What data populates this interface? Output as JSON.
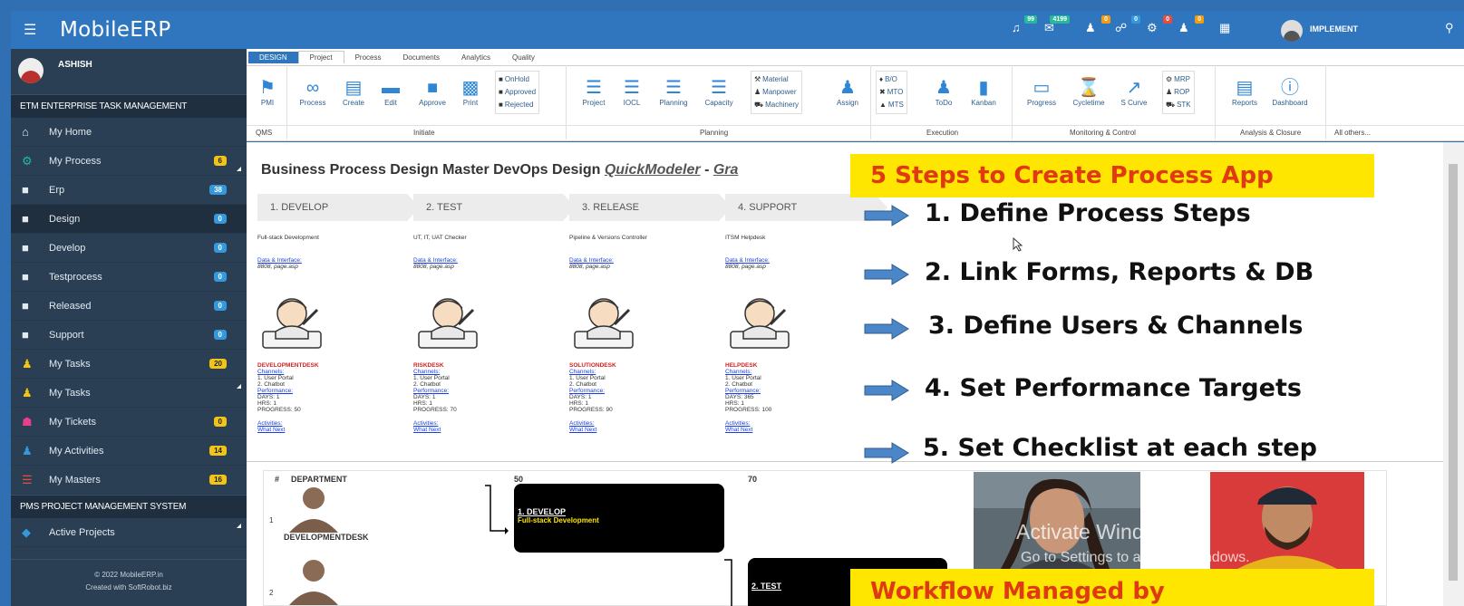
{
  "brand": "MobileERP",
  "user": "ASHISH",
  "sidebar": {
    "section1": "ETM ENTERPRISE TASK MANAGEMENT",
    "items": [
      {
        "label": "My Home",
        "badge": ""
      },
      {
        "label": "My Process",
        "badge": "6"
      },
      {
        "label": "Erp",
        "badge": "38"
      },
      {
        "label": "Design",
        "badge": "0"
      },
      {
        "label": "Develop",
        "badge": "0"
      },
      {
        "label": "Testprocess",
        "badge": "0"
      },
      {
        "label": "Released",
        "badge": "0"
      },
      {
        "label": "Support",
        "badge": "0"
      },
      {
        "label": "My Tasks",
        "badge": "20"
      },
      {
        "label": "My Tasks",
        "badge": ""
      },
      {
        "label": "My Tickets",
        "badge": "0"
      },
      {
        "label": "My Activities",
        "badge": "14"
      },
      {
        "label": "My Masters",
        "badge": "16"
      }
    ],
    "section2": "PMS PROJECT MANAGEMENT SYSTEM",
    "items2": [
      {
        "label": "Active Projects"
      }
    ],
    "footer_line1": "© 2022 MobileERP.in",
    "footer_line2": "Created with SoftRobot.biz"
  },
  "topbar": {
    "badges": [
      "99",
      "4199",
      "0",
      "0",
      "0",
      "0"
    ],
    "user": "IMPLEMENT"
  },
  "ribbon": {
    "tabs": [
      "DESIGN",
      "Project",
      "Process",
      "Documents",
      "Analytics",
      "Quality"
    ],
    "buttons": {
      "pmi": "PMI",
      "process": "Process",
      "create": "Create",
      "edit": "Edit",
      "approve": "Approve",
      "print": "Print",
      "project": "Project",
      "iocl": "IOCL",
      "planning": "Planning",
      "capacity": "Capacity",
      "assign": "Assign",
      "todo": "ToDo",
      "kanban": "Kanban",
      "progress": "Progress",
      "cycletime": "Cycletime",
      "scurve": "S Curve",
      "reports": "Reports",
      "dashboard": "Dashboard"
    },
    "status_list": [
      "OnHold",
      "Approved",
      "Rejected"
    ],
    "resource_list": [
      "Material",
      "Manpower",
      "Machinery"
    ],
    "mode_list": [
      "B/O",
      "MTO",
      "MTS"
    ],
    "mrp_list": [
      "MRP",
      "ROP",
      "STK"
    ],
    "groups": [
      "QMS",
      "Initiate",
      "Planning",
      "Execution",
      "Monitoring & Control",
      "Analysis & Closure",
      "All others..."
    ]
  },
  "main": {
    "title_prefix": "Business Process Design Master DevOps Design ",
    "title_link": "QuickModeler",
    "title_sep": " - ",
    "title_tail": "Gra",
    "steps": [
      "1. DEVELOP",
      "2. TEST",
      "3. RELEASE",
      "4. SUPPORT"
    ],
    "columns": [
      {
        "type": "Full-stack Development",
        "desk": "DEVELOPMENTDESK",
        "days": "DAYS: 1",
        "hrs": "HRS: 1",
        "progress": "PROGRESS: 50"
      },
      {
        "type": "UT, IT, UAT Checker",
        "desk": "RISKDESK",
        "days": "DAYS: 1",
        "hrs": "HRS: 1",
        "progress": "PROGRESS: 70"
      },
      {
        "type": "Pipeline & Versions Controller",
        "desk": "SOLUTIONDESK",
        "days": "DAYS: 1",
        "hrs": "HRS: 1",
        "progress": "PROGRESS: 90"
      },
      {
        "type": "ITSM Helpdesk",
        "desk": "HELPDESK",
        "days": "DAYS: 365",
        "hrs": "HRS: 1",
        "progress": "PROGRESS: 100"
      }
    ],
    "data_iface": "Data & Interface:",
    "data_page": "8808, page.asp",
    "channels": "Channels:",
    "ch1": "1. User Portal",
    "ch2": "2. Chatbot",
    "performance": "Performance:",
    "activities": "Activities:",
    "whatnext": "What Next",
    "workflow": {
      "col_hash": "#",
      "col_dept": "DEPARTMENT",
      "col_50": "50",
      "col_70": "70",
      "row1_num": "1",
      "row1_dept": "DEVELOPMENTDESK",
      "row2_num": "2",
      "box1_title": "1. DEVELOP",
      "box1_sub": "Full-stack Development",
      "box2_title": "2. TEST"
    }
  },
  "overlay": {
    "header": "5 Steps to Create Process App",
    "steps": [
      "1. Define Process Steps",
      "2. Link Forms, Reports & DB",
      "3. Define Users & Channels",
      "4. Set Performance Targets",
      "5. Set Checklist at each step"
    ],
    "footer": "Workflow Managed by",
    "watermark1": "Activate Windows",
    "watermark2": "Go to Settings to activate Windows."
  },
  "colors": {
    "sidebar": "#2a3f54",
    "topbar": "#2f76be",
    "overlay_yellow": "#ffe600",
    "overlay_red": "#e03a12",
    "desk_red": "#d41f1f",
    "link_blue": "#1a3fe0"
  }
}
